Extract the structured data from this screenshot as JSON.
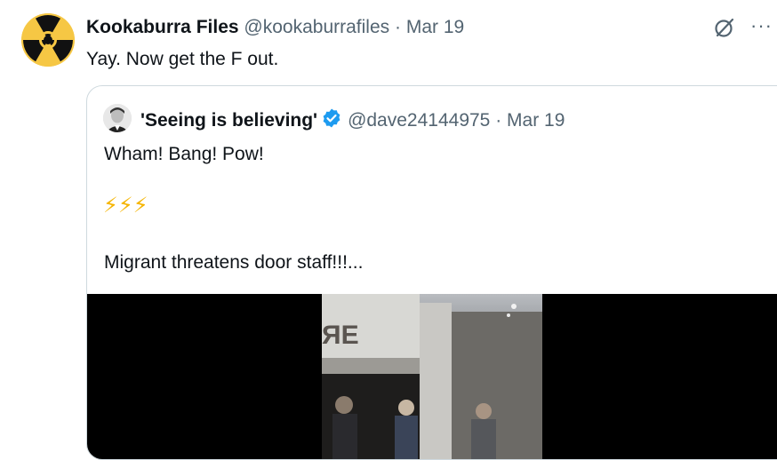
{
  "tweet": {
    "display_name": "Kookaburra Files",
    "handle": "@kookaburrafiles",
    "separator": "·",
    "date": "Mar 19",
    "text": "Yay. Now get the F out.",
    "more_label": "···"
  },
  "quote": {
    "display_name": "'Seeing is believing'",
    "handle": "@dave24144975",
    "separator": "·",
    "date": "Mar 19",
    "lines": [
      "Wham! Bang! Pow!",
      "⚡⚡⚡",
      "Migrant threatens door staff!!!..."
    ]
  },
  "colors": {
    "muted": "#536471",
    "verified": "#1d9bf0",
    "border": "#cfd9de",
    "avatar_bg": "#f6c744"
  },
  "icons": [
    "radiation-icon",
    "grok-icon",
    "more-icon",
    "verified-badge-icon"
  ]
}
